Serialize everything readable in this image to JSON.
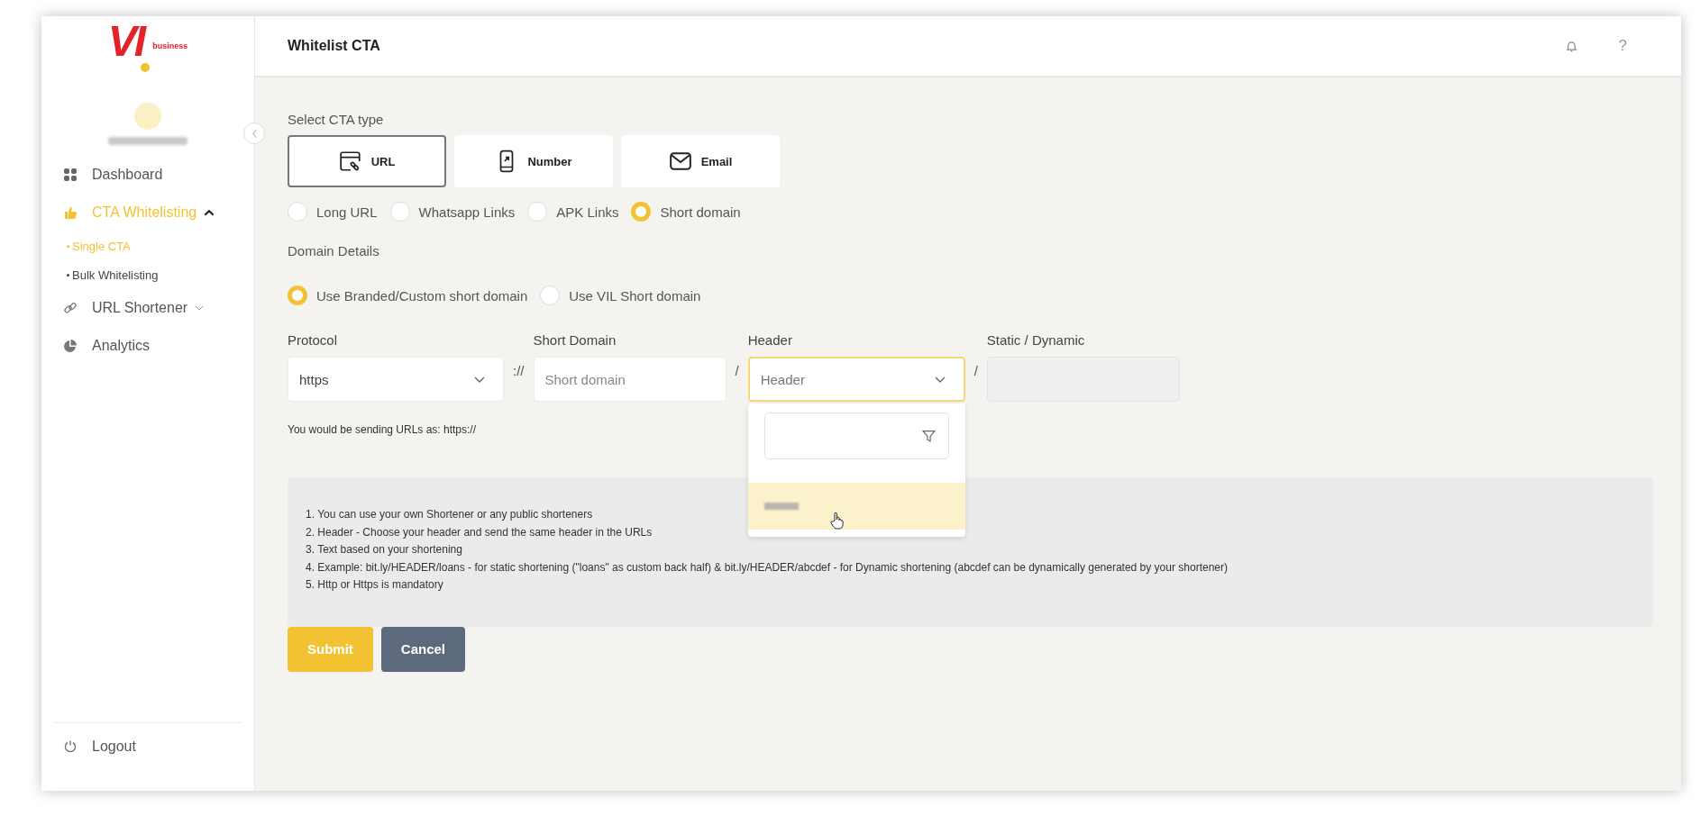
{
  "brand": {
    "logo": "VI",
    "tagline": "business"
  },
  "sidebar": {
    "items": [
      {
        "label": "Dashboard",
        "kind": "link",
        "selected": false
      },
      {
        "label": "CTA Whitelisting",
        "kind": "group",
        "selected": true,
        "expanded": true,
        "children": [
          {
            "label": "Single CTA",
            "selected": true
          },
          {
            "label": "Bulk Whitelisting",
            "selected": false
          }
        ]
      },
      {
        "label": "URL Shortener",
        "kind": "group",
        "selected": false,
        "expanded": false
      },
      {
        "label": "Analytics",
        "kind": "link",
        "selected": false
      }
    ],
    "logout": "Logout"
  },
  "header": {
    "title": "Whitelist CTA",
    "help": "?"
  },
  "cta_type": {
    "label": "Select CTA type",
    "options": [
      {
        "label": "URL",
        "selected": true
      },
      {
        "label": "Number",
        "selected": false
      },
      {
        "label": "Email",
        "selected": false
      }
    ]
  },
  "link_types": [
    {
      "label": "Long URL",
      "selected": false
    },
    {
      "label": "Whatsapp Links",
      "selected": false
    },
    {
      "label": "APK Links",
      "selected": false
    },
    {
      "label": "Short domain",
      "selected": true
    }
  ],
  "domain_details": {
    "label": "Domain Details",
    "options": [
      {
        "label": "Use Branded/Custom short domain",
        "selected": true
      },
      {
        "label": "Use VIL Short domain",
        "selected": false
      }
    ]
  },
  "fields": [
    {
      "kind": "select",
      "label": "Protocol",
      "value": "https",
      "expanded": false,
      "separator": "://"
    },
    {
      "kind": "input",
      "label": "Short Domain",
      "placeholder": "Short domain",
      "disabled": false,
      "separator": "/"
    },
    {
      "kind": "select",
      "label": "Header",
      "placeholder": "Header",
      "expanded": true,
      "separator": "/"
    },
    {
      "kind": "input",
      "label": "Static / Dynamic",
      "disabled": true
    }
  ],
  "header_dropdown": {
    "options": [
      {
        "selected": true
      }
    ]
  },
  "preview": "You would be sending URLs as: https://",
  "notes": [
    "1. You can use your own Shortener or any public shorteners",
    "2. Header - Choose your header and send the same header in the URLs",
    "3. Text based on your shortening",
    "4. Example: bit.ly/HEADER/loans - for static shortening (\"loans\" as custom back half) & bit.ly/HEADER/abcdef - for Dynamic shortening (abcdef can be dynamically generated by your shortener)",
    "5. Http or Https is mandatory"
  ],
  "buttons": [
    {
      "label": "Submit",
      "kind": "primary"
    },
    {
      "label": "Cancel",
      "kind": "secondary"
    }
  ]
}
